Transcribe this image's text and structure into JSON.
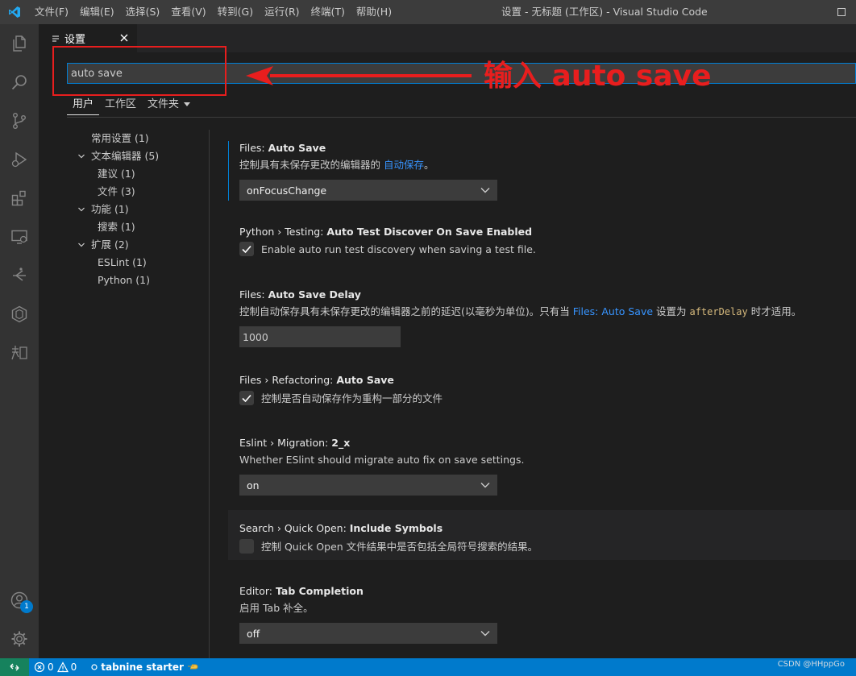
{
  "menubar": {
    "items": [
      "文件(F)",
      "编辑(E)",
      "选择(S)",
      "查看(V)",
      "转到(G)",
      "运行(R)",
      "终端(T)",
      "帮助(H)"
    ],
    "window_title": "设置 - 无标题 (工作区) - Visual Studio Code"
  },
  "activity_bar": {
    "icons": [
      "explorer-icon",
      "search-icon",
      "source-control-icon",
      "run-debug-icon",
      "extensions-icon",
      "remote-explorer-icon",
      "gitlens-icon",
      "docker-icon",
      "zhihu-icon"
    ],
    "accounts_badge": "1"
  },
  "tab": {
    "label": "设置"
  },
  "search": {
    "value": "auto save"
  },
  "annotation": {
    "text": "输入 auto save",
    "color": "#e81e1e"
  },
  "scopes": {
    "user": "用户",
    "workspace": "工作区",
    "folder": "文件夹"
  },
  "toc": [
    {
      "label": "常用设置 (1)",
      "level": 0,
      "chevron": false
    },
    {
      "label": "文本编辑器 (5)",
      "level": 0,
      "chevron": true
    },
    {
      "label": "建议 (1)",
      "level": 1,
      "chevron": false
    },
    {
      "label": "文件 (3)",
      "level": 1,
      "chevron": false
    },
    {
      "label": "功能 (1)",
      "level": 0,
      "chevron": true
    },
    {
      "label": "搜索 (1)",
      "level": 1,
      "chevron": false
    },
    {
      "label": "扩展 (2)",
      "level": 0,
      "chevron": true
    },
    {
      "label": "ESLint (1)",
      "level": 1,
      "chevron": false
    },
    {
      "label": "Python (1)",
      "level": 1,
      "chevron": false
    }
  ],
  "settings": [
    {
      "category": "Files: ",
      "name": "Auto Save",
      "desc_prefix": "控制具有未保存更改的编辑器的 ",
      "desc_link": "自动保存",
      "desc_suffix": "。",
      "control": "select",
      "value": "onFocusChange"
    },
    {
      "category": "Python › Testing: ",
      "name": "Auto Test Discover On Save Enabled",
      "control": "checkbox",
      "checked": true,
      "check_label": "Enable auto run test discovery when saving a test file."
    },
    {
      "category": "Files: ",
      "name": "Auto Save Delay",
      "desc_prefix": "控制自动保存具有未保存更改的编辑器之前的延迟(以毫秒为单位)。只有当 ",
      "desc_link": "Files: Auto Save",
      "desc_mid": " 设置为 ",
      "desc_code": "afterDelay",
      "desc_suffix": " 时才适用。",
      "control": "text",
      "value": "1000"
    },
    {
      "category": "Files › Refactoring: ",
      "name": "Auto Save",
      "control": "checkbox",
      "checked": true,
      "check_label": "控制是否自动保存作为重构一部分的文件"
    },
    {
      "category": "Eslint › Migration: ",
      "name": "2_x",
      "description": "Whether ESlint should migrate auto fix on save settings.",
      "control": "select",
      "value": "on"
    },
    {
      "category": "Search › Quick Open: ",
      "name": "Include Symbols",
      "control": "checkbox",
      "checked": false,
      "check_label": "控制 Quick Open 文件结果中是否包括全局符号搜索的结果。"
    },
    {
      "category": "Editor: ",
      "name": "Tab Completion",
      "description": "启用 Tab 补全。",
      "control": "select",
      "value": "off"
    }
  ],
  "statusbar": {
    "errors": "0",
    "warnings": "0",
    "tabnine": "tabnine starter"
  },
  "watermark": "CSDN @HHppGo"
}
